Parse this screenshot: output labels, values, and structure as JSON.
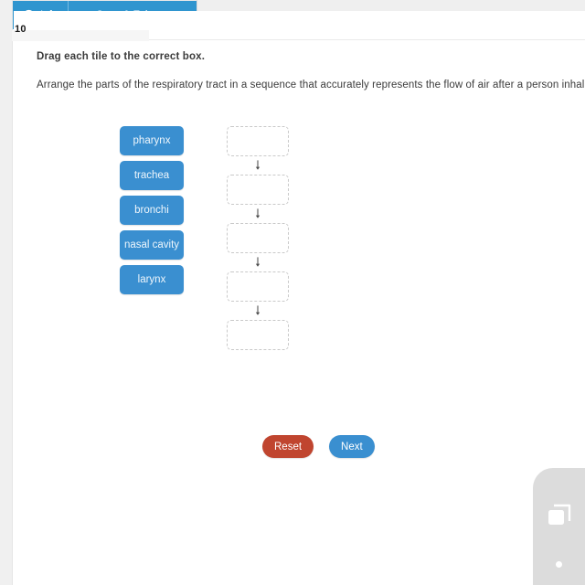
{
  "toolbar": {
    "items": [
      {
        "label": "Info",
        "icon": "info-icon"
      },
      {
        "label": "Save & Exit",
        "icon": "exit-arrow-icon"
      }
    ]
  },
  "question": {
    "number": "10"
  },
  "content": {
    "instruction": "Drag each tile to the correct box.",
    "prompt": "Arrange the parts of the respiratory tract in a sequence that accurately represents the flow of air after a person inhales."
  },
  "tiles": [
    {
      "label": "pharynx"
    },
    {
      "label": "trachea"
    },
    {
      "label": "bronchi"
    },
    {
      "label": "nasal cavity"
    },
    {
      "label": "larynx"
    }
  ],
  "dropboxes": [
    {
      "value": ""
    },
    {
      "value": ""
    },
    {
      "value": ""
    },
    {
      "value": ""
    },
    {
      "value": ""
    }
  ],
  "arrows": [
    {
      "glyph": "down-arrow-icon"
    },
    {
      "glyph": "down-arrow-icon"
    },
    {
      "glyph": "down-arrow-icon"
    },
    {
      "glyph": "down-arrow-icon"
    }
  ],
  "actions": {
    "reset_label": "Reset",
    "next_label": "Next"
  },
  "colors": {
    "toolbar_blue": "#2f95cf",
    "tile_blue": "#3a8fd0",
    "reset_red": "#c0452f",
    "next_blue": "#3a8fd0",
    "widget_gray": "#dcdcdc"
  }
}
